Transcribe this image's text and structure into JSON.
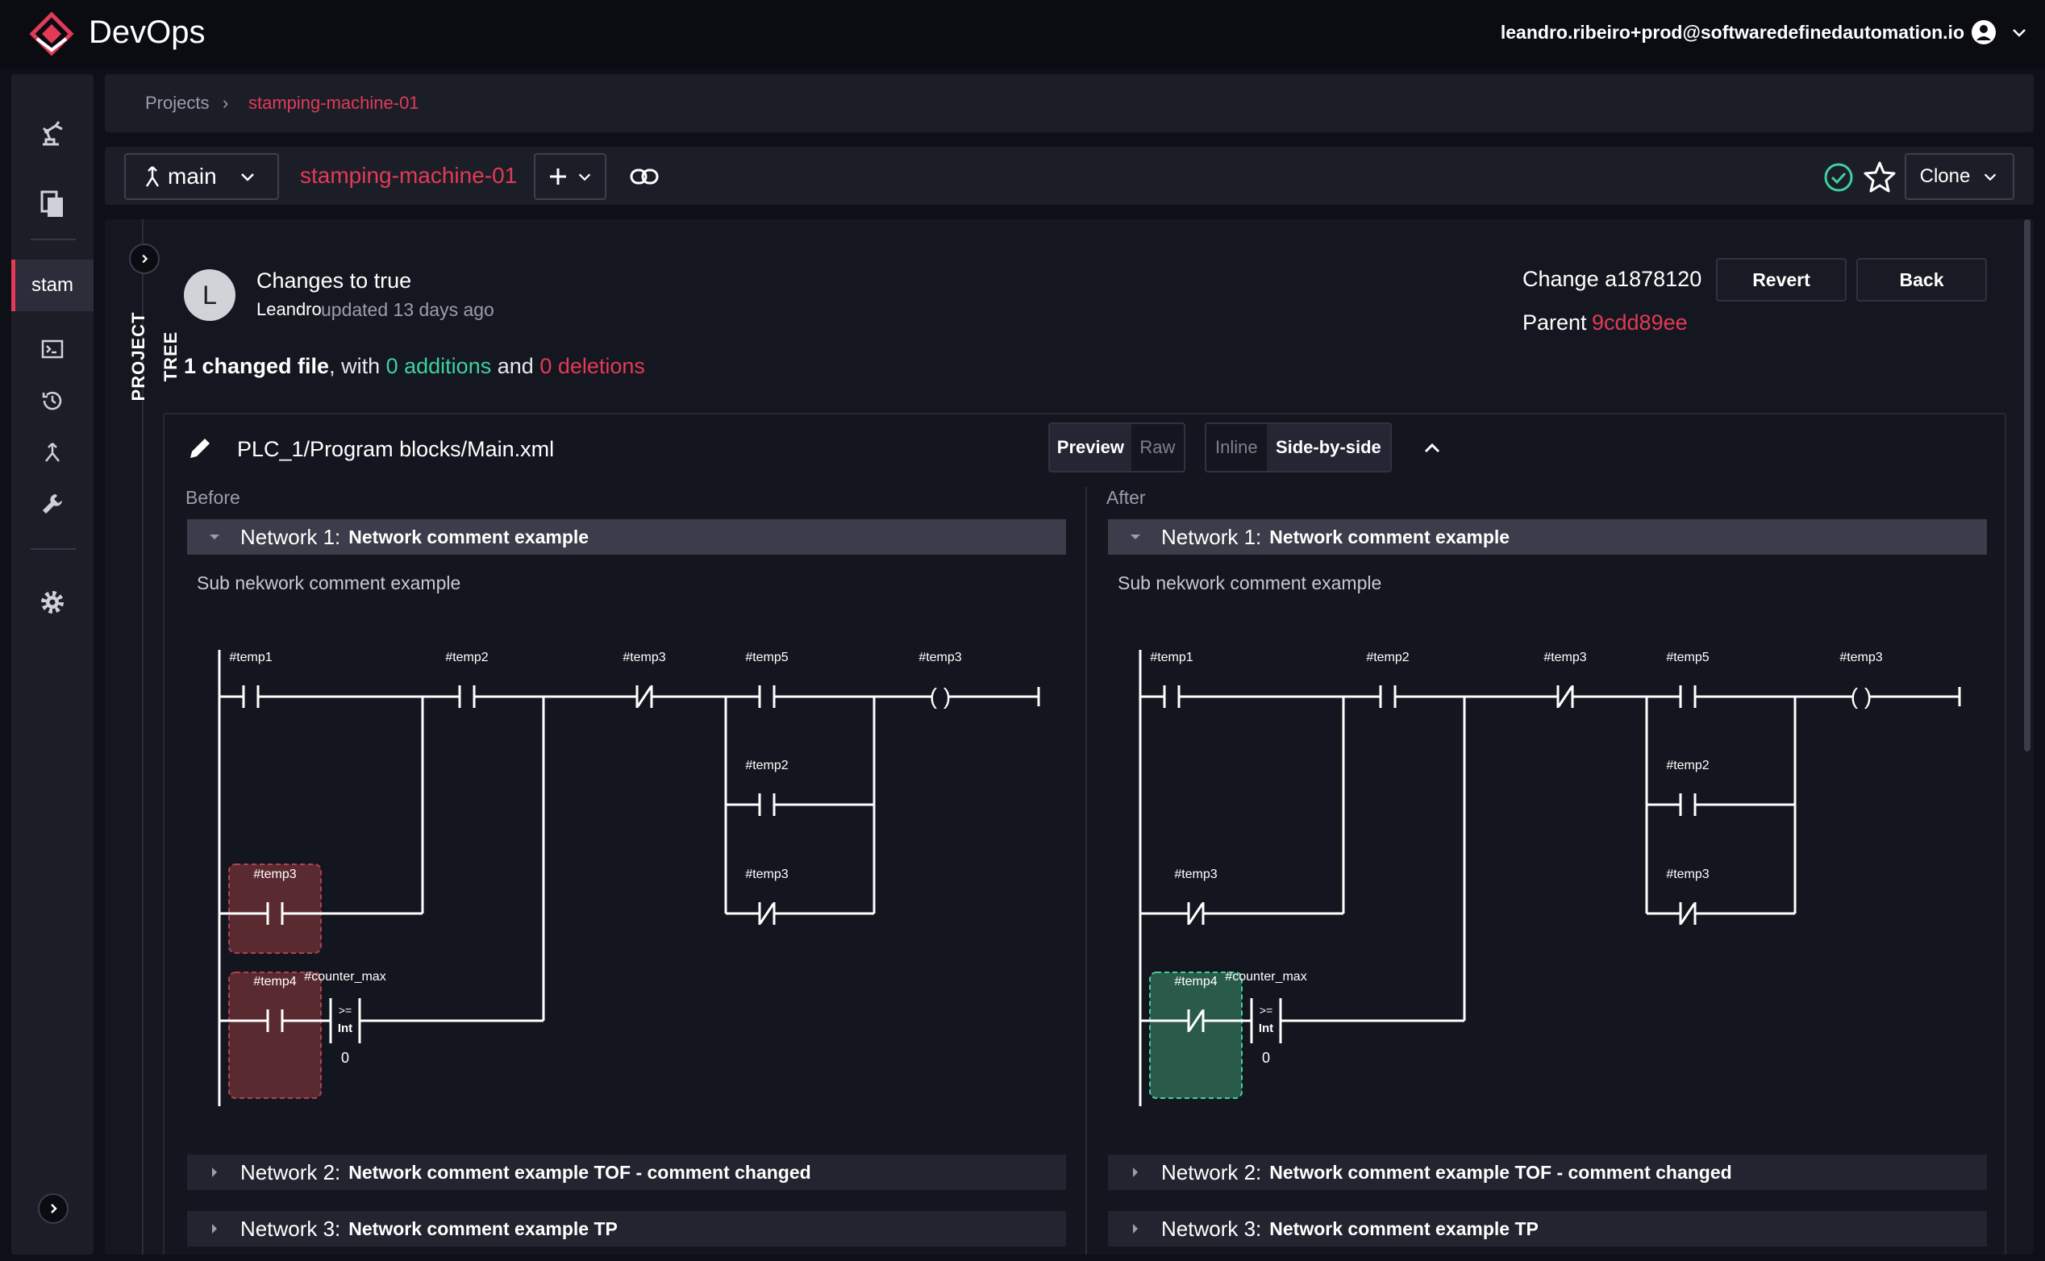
{
  "app": {
    "name": "DevOps",
    "user_email": "leandro.ribeiro+prod@softwaredefinedautomation.io"
  },
  "colors": {
    "accent": "#e23a57",
    "addition": "#3fd0a0",
    "deletion": "#e23a57",
    "removed_fill": "#5a2a31",
    "added_fill": "#2a5a4a"
  },
  "sidebar": {
    "icons": [
      "robot-arm-icon",
      "files-icon",
      "terminal-icon",
      "history-icon",
      "branch-icon",
      "wrench-icon",
      "settings-icon",
      "expand-icon"
    ],
    "project_short": "stam"
  },
  "breadcrumb": {
    "root": "Projects",
    "separator": "›",
    "current": "stamping-machine-01"
  },
  "toolbar": {
    "branch": "main",
    "repo": "stamping-machine-01",
    "clone_label": "Clone"
  },
  "tree": {
    "label": "PROJECT TREE"
  },
  "commit": {
    "avatar_initial": "L",
    "title": "Changes to true",
    "author": "Leandro",
    "updated": "updated 13 days ago",
    "change_label": "Change a1878120",
    "parent_prefix": "Parent",
    "parent_hash": "9cdd89ee",
    "revert_label": "Revert",
    "back_label": "Back"
  },
  "summary": {
    "files": "1 changed file",
    "with": ", with",
    "additions": "0 additions",
    "and": "and",
    "deletions": "0 deletions"
  },
  "file": {
    "path": "PLC_1/Program blocks/Main.xml",
    "view_modes": [
      "Preview",
      "Raw"
    ],
    "view_active": "Preview",
    "layout_modes": [
      "Inline",
      "Side-by-side"
    ],
    "layout_active": "Side-by-side"
  },
  "panes": {
    "before": {
      "heading": "Before"
    },
    "after": {
      "heading": "After"
    }
  },
  "networks": [
    {
      "number": "Network 1:",
      "comment": "Network comment example",
      "sub_comment": "Sub nekwork comment example",
      "expanded": true
    },
    {
      "number": "Network 2:",
      "comment": "Network comment example TOF - comment changed",
      "expanded": false
    },
    {
      "number": "Network 3:",
      "comment": "Network comment example TP",
      "expanded": false
    }
  ],
  "ladder": {
    "tags": {
      "temp1": "#temp1",
      "temp2": "#temp2",
      "temp3": "#temp3",
      "temp5": "#temp5",
      "temp4": "#temp4",
      "counter_max": "#counter_max"
    },
    "compare_op": ">=",
    "compare_type": "Int",
    "compare_value": "0",
    "coil_symbol": "( )"
  }
}
